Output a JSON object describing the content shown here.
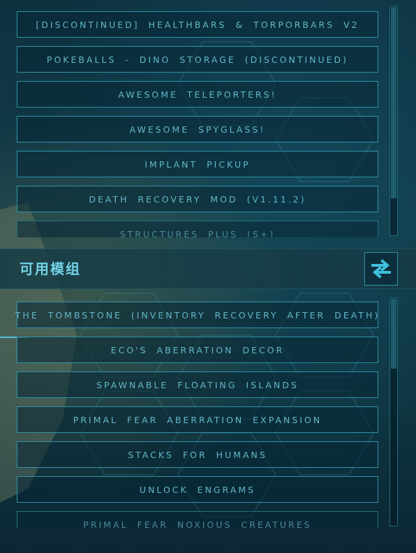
{
  "active_mods": [
    "[DISCONTINUED] HEALTHBARS & TORPORBARS V2",
    "POKEBALLS - DINO STORAGE (DISCONTINUED)",
    "AWESOME TELEPORTERS!",
    "AWESOME SPYGLASS!",
    "IMPLANT PICKUP",
    "DEATH RECOVERY MOD (V1.11.2)",
    "STRUCTURES PLUS (S+)"
  ],
  "available_header": {
    "title": "可用模组",
    "swap_icon": "swap-arrows-icon"
  },
  "available_mods": [
    "THE TOMBSTONE  (INVENTORY RECOVERY AFTER DEATH)",
    "ECO'S ABERRATION DECOR",
    "SPAWNABLE FLOATING ISLANDS",
    "PRIMAL FEAR ABERRATION EXPANSION",
    "STACKS FOR HUMANS",
    "UNLOCK ENGRAMS",
    "PRIMAL FEAR NOXIOUS CREATURES"
  ],
  "colors": {
    "accent": "#2e93a8",
    "text": "#63b7c8",
    "title": "#73d2e6"
  }
}
